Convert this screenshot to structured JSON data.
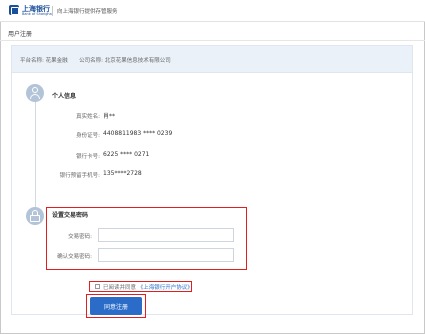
{
  "header": {
    "logo_cn": "上海银行",
    "logo_en": "Bank of Shanghai",
    "subtitle": "向上海银行提供存管服务"
  },
  "page": {
    "title": "用户注册"
  },
  "platform": {
    "platform_label": "平台名称:",
    "platform_name": "花果金融",
    "company_label": "公司名称:",
    "company_name": "北京花果信息技术有限公司"
  },
  "personal": {
    "title": "个人信息",
    "rows": [
      {
        "label": "真实姓名:",
        "value": "肖**"
      },
      {
        "label": "身份证号:",
        "value": "4408811983 **** 0239"
      },
      {
        "label": "银行卡号:",
        "value": "6225 **** 0271"
      },
      {
        "label": "银行预留手机号:",
        "value": "135****2728"
      }
    ]
  },
  "password": {
    "title": "设置交易密码",
    "pw_label": "交易密码:",
    "confirm_label": "确认交易密码:",
    "pw_value": "",
    "confirm_value": ""
  },
  "agreement": {
    "prefix": "已阅读并同意",
    "link": "《上海银行开户协议》",
    "checked": false
  },
  "submit": {
    "label": "同意注册"
  },
  "icons": {
    "section1": "user-icon",
    "section2": "lock-icon",
    "logo": "bank-logo-icon"
  },
  "colors": {
    "brand": "#1a4f9a",
    "button": "#2a6cc8",
    "highlight": "#e02020",
    "platform_bar": "#eaf1f9",
    "timeline_node": "#b3c4d8"
  }
}
